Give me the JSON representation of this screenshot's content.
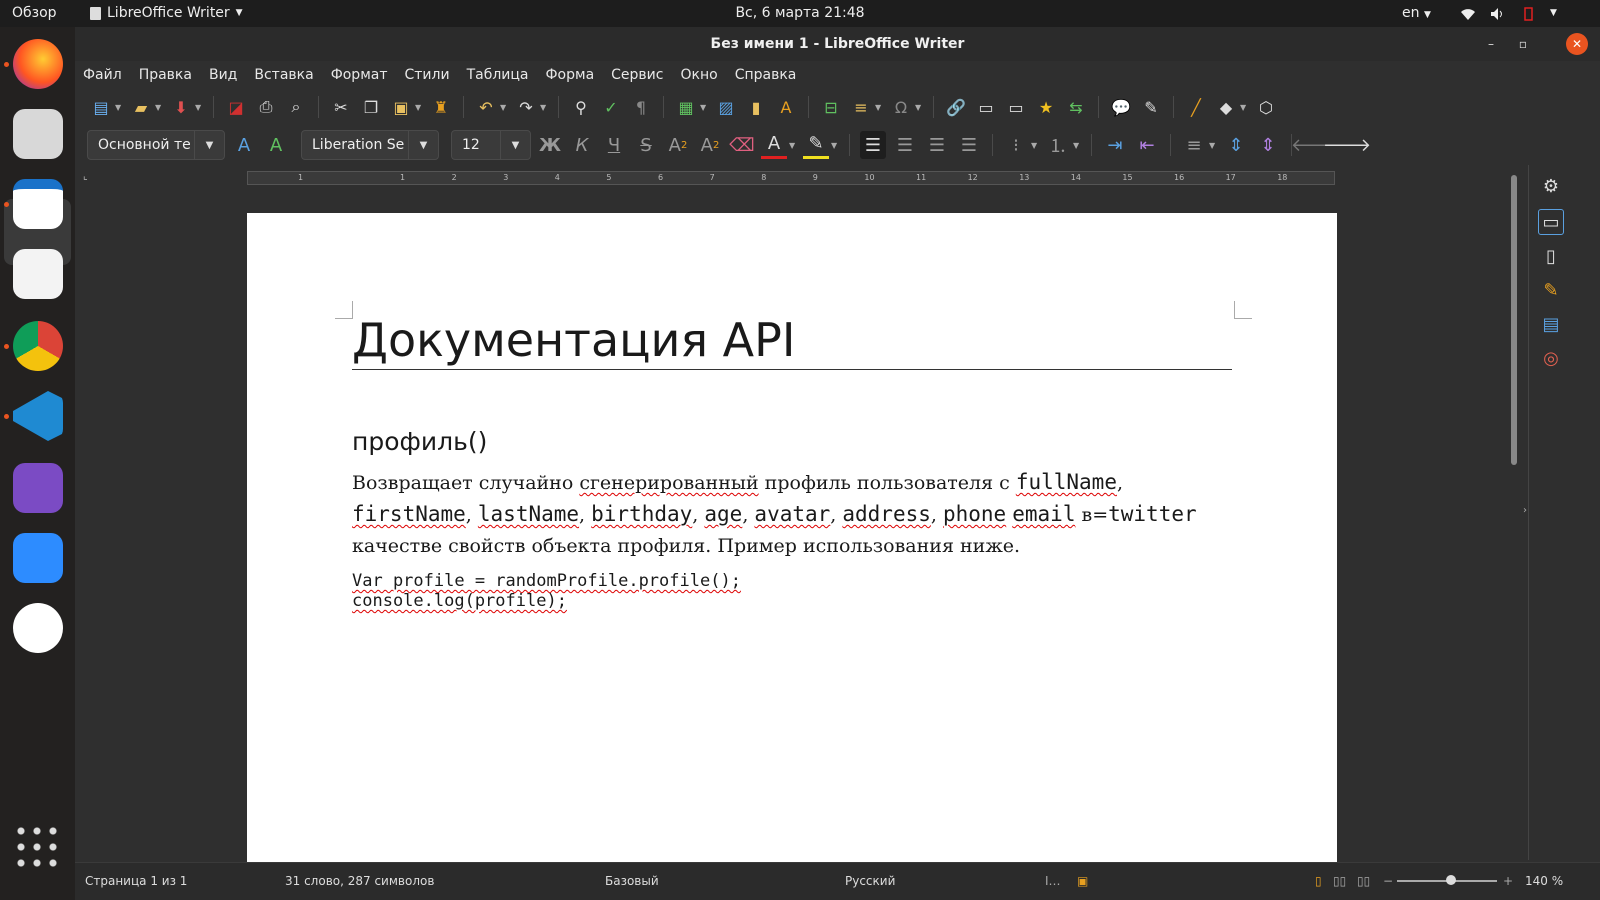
{
  "topbar": {
    "overview": "Обзор",
    "app_name": "LibreOffice Writer",
    "clock": "Вс, 6 марта  21:48",
    "lang": "en"
  },
  "dock": {
    "apps": [
      "firefox",
      "files",
      "libreoffice-writer",
      "text-editor",
      "chrome",
      "vscode",
      "github-desktop",
      "zoom",
      "slack",
      "show-applications"
    ]
  },
  "window": {
    "title": "Без имени 1 - LibreOffice Writer"
  },
  "menu": [
    "Файл",
    "Правка",
    "Вид",
    "Вставка",
    "Формат",
    "Стили",
    "Таблица",
    "Форма",
    "Сервис",
    "Окно",
    "Справка"
  ],
  "format_toolbar": {
    "paragraph_style": "Основной те",
    "font_name": "Liberation Se",
    "font_size": "12"
  },
  "ruler": {
    "ticks": [
      "1",
      "1",
      "2",
      "3",
      "4",
      "5",
      "6",
      "7",
      "8",
      "9",
      "10",
      "11",
      "12",
      "13",
      "14",
      "15",
      "16",
      "17",
      "18"
    ]
  },
  "document": {
    "heading1": "Документация API",
    "heading2": "профиль()",
    "p_text1": "Возвращает случайно ",
    "p_sq1": "сгенерированный",
    "p_text2": " профиль пользователя с ",
    "p_code1": "fullName",
    "p_sep1": ", ",
    "p_code2": "firstName",
    "p_sep2": ", ",
    "p_code3": "lastName",
    "p_sep3": ", ",
    "p_code4": "birthday",
    "p_sep4": ", ",
    "p_code5": "age",
    "p_sep5": ", ",
    "p_code6": "avatar",
    "p_sep6": ", ",
    "p_code7": "address",
    "p_sep7": ", ",
    "p_code8": "phone",
    "p_sep8": " ",
    "p_code9": "email",
    "p_text3": " в=",
    "p_code10": "twitter",
    "p_text4": " качестве свойств объекта профиля. Пример использования ниже.",
    "code_line1": "Var profile = randomProfile.profile();",
    "code_line2": "console.log(profile);"
  },
  "status": {
    "page": "Страница 1 из 1",
    "words": "31 слово, 287 символов",
    "page_style": "Базовый",
    "language": "Русский",
    "zoom": "140 %"
  },
  "colors": {
    "accent": "#e95420",
    "spell_underline": "#dd0000"
  }
}
